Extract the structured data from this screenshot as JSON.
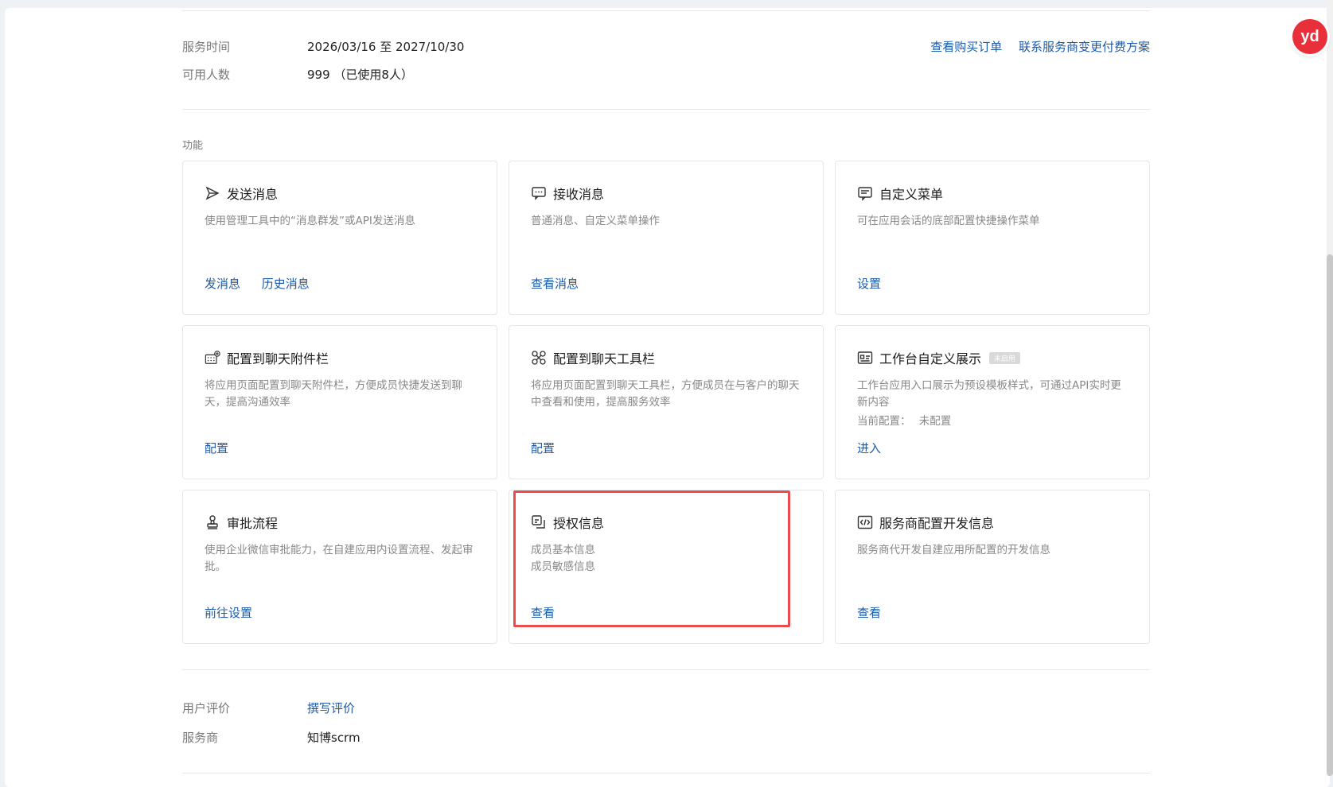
{
  "info": {
    "service_time_label": "服务时间",
    "service_time_value": "2026/03/16 至 2027/10/30",
    "users_label": "可用人数",
    "users_value": "999 （已使用8人）",
    "view_orders": "查看购买订单",
    "contact_provider": "联系服务商变更付费方案"
  },
  "features_label": "功能",
  "cards": [
    {
      "icon": "send-icon",
      "title": "发送消息",
      "desc": "使用管理工具中的“消息群发”或API发送消息",
      "actions": [
        "发消息",
        "历史消息"
      ]
    },
    {
      "icon": "chat-bubble-icon",
      "title": "接收消息",
      "desc": "普通消息、自定义菜单操作",
      "actions": [
        "查看消息"
      ]
    },
    {
      "icon": "menu-icon",
      "title": "自定义菜单",
      "desc": "可在应用会话的底部配置快捷操作菜单",
      "actions": [
        "设置"
      ]
    },
    {
      "icon": "attachment-bar-icon",
      "title": "配置到聊天附件栏",
      "desc": "将应用页面配置到聊天附件栏，方便成员快捷发送到聊天，提高沟通效率",
      "actions": [
        "配置"
      ]
    },
    {
      "icon": "toolbar-icon",
      "title": "配置到聊天工具栏",
      "desc": "将应用页面配置到聊天工具栏，方便成员在与客户的聊天中查看和使用，提高服务效率",
      "actions": [
        "配置"
      ]
    },
    {
      "icon": "workbench-icon",
      "title": "工作台自定义展示",
      "tag": "未启用",
      "desc": "工作台应用入口展示为预设模板样式，可通过API实时更新内容",
      "current_label": "当前配置：",
      "current_value": "未配置",
      "actions": [
        "进入"
      ]
    },
    {
      "icon": "stamp-icon",
      "title": "审批流程",
      "desc": "使用企业微信审批能力，在自建应用内设置流程、发起审批。",
      "actions": [
        "前往设置"
      ]
    },
    {
      "icon": "authorization-icon",
      "title": "授权信息",
      "desc": "成员基本信息",
      "desc2": "成员敏感信息",
      "actions": [
        "查看"
      ]
    },
    {
      "icon": "code-icon",
      "title": "服务商配置开发信息",
      "desc": "服务商代开发自建应用所配置的开发信息",
      "actions": [
        "查看"
      ]
    }
  ],
  "footer": {
    "review_label": "用户评价",
    "review_link": "撰写评价",
    "provider_label": "服务商",
    "provider_value": "知博scrm"
  },
  "badge_text": "yd",
  "colors": {
    "link": "#1e5aa8",
    "highlight": "#e94c4c",
    "badge": "#e8303b"
  }
}
